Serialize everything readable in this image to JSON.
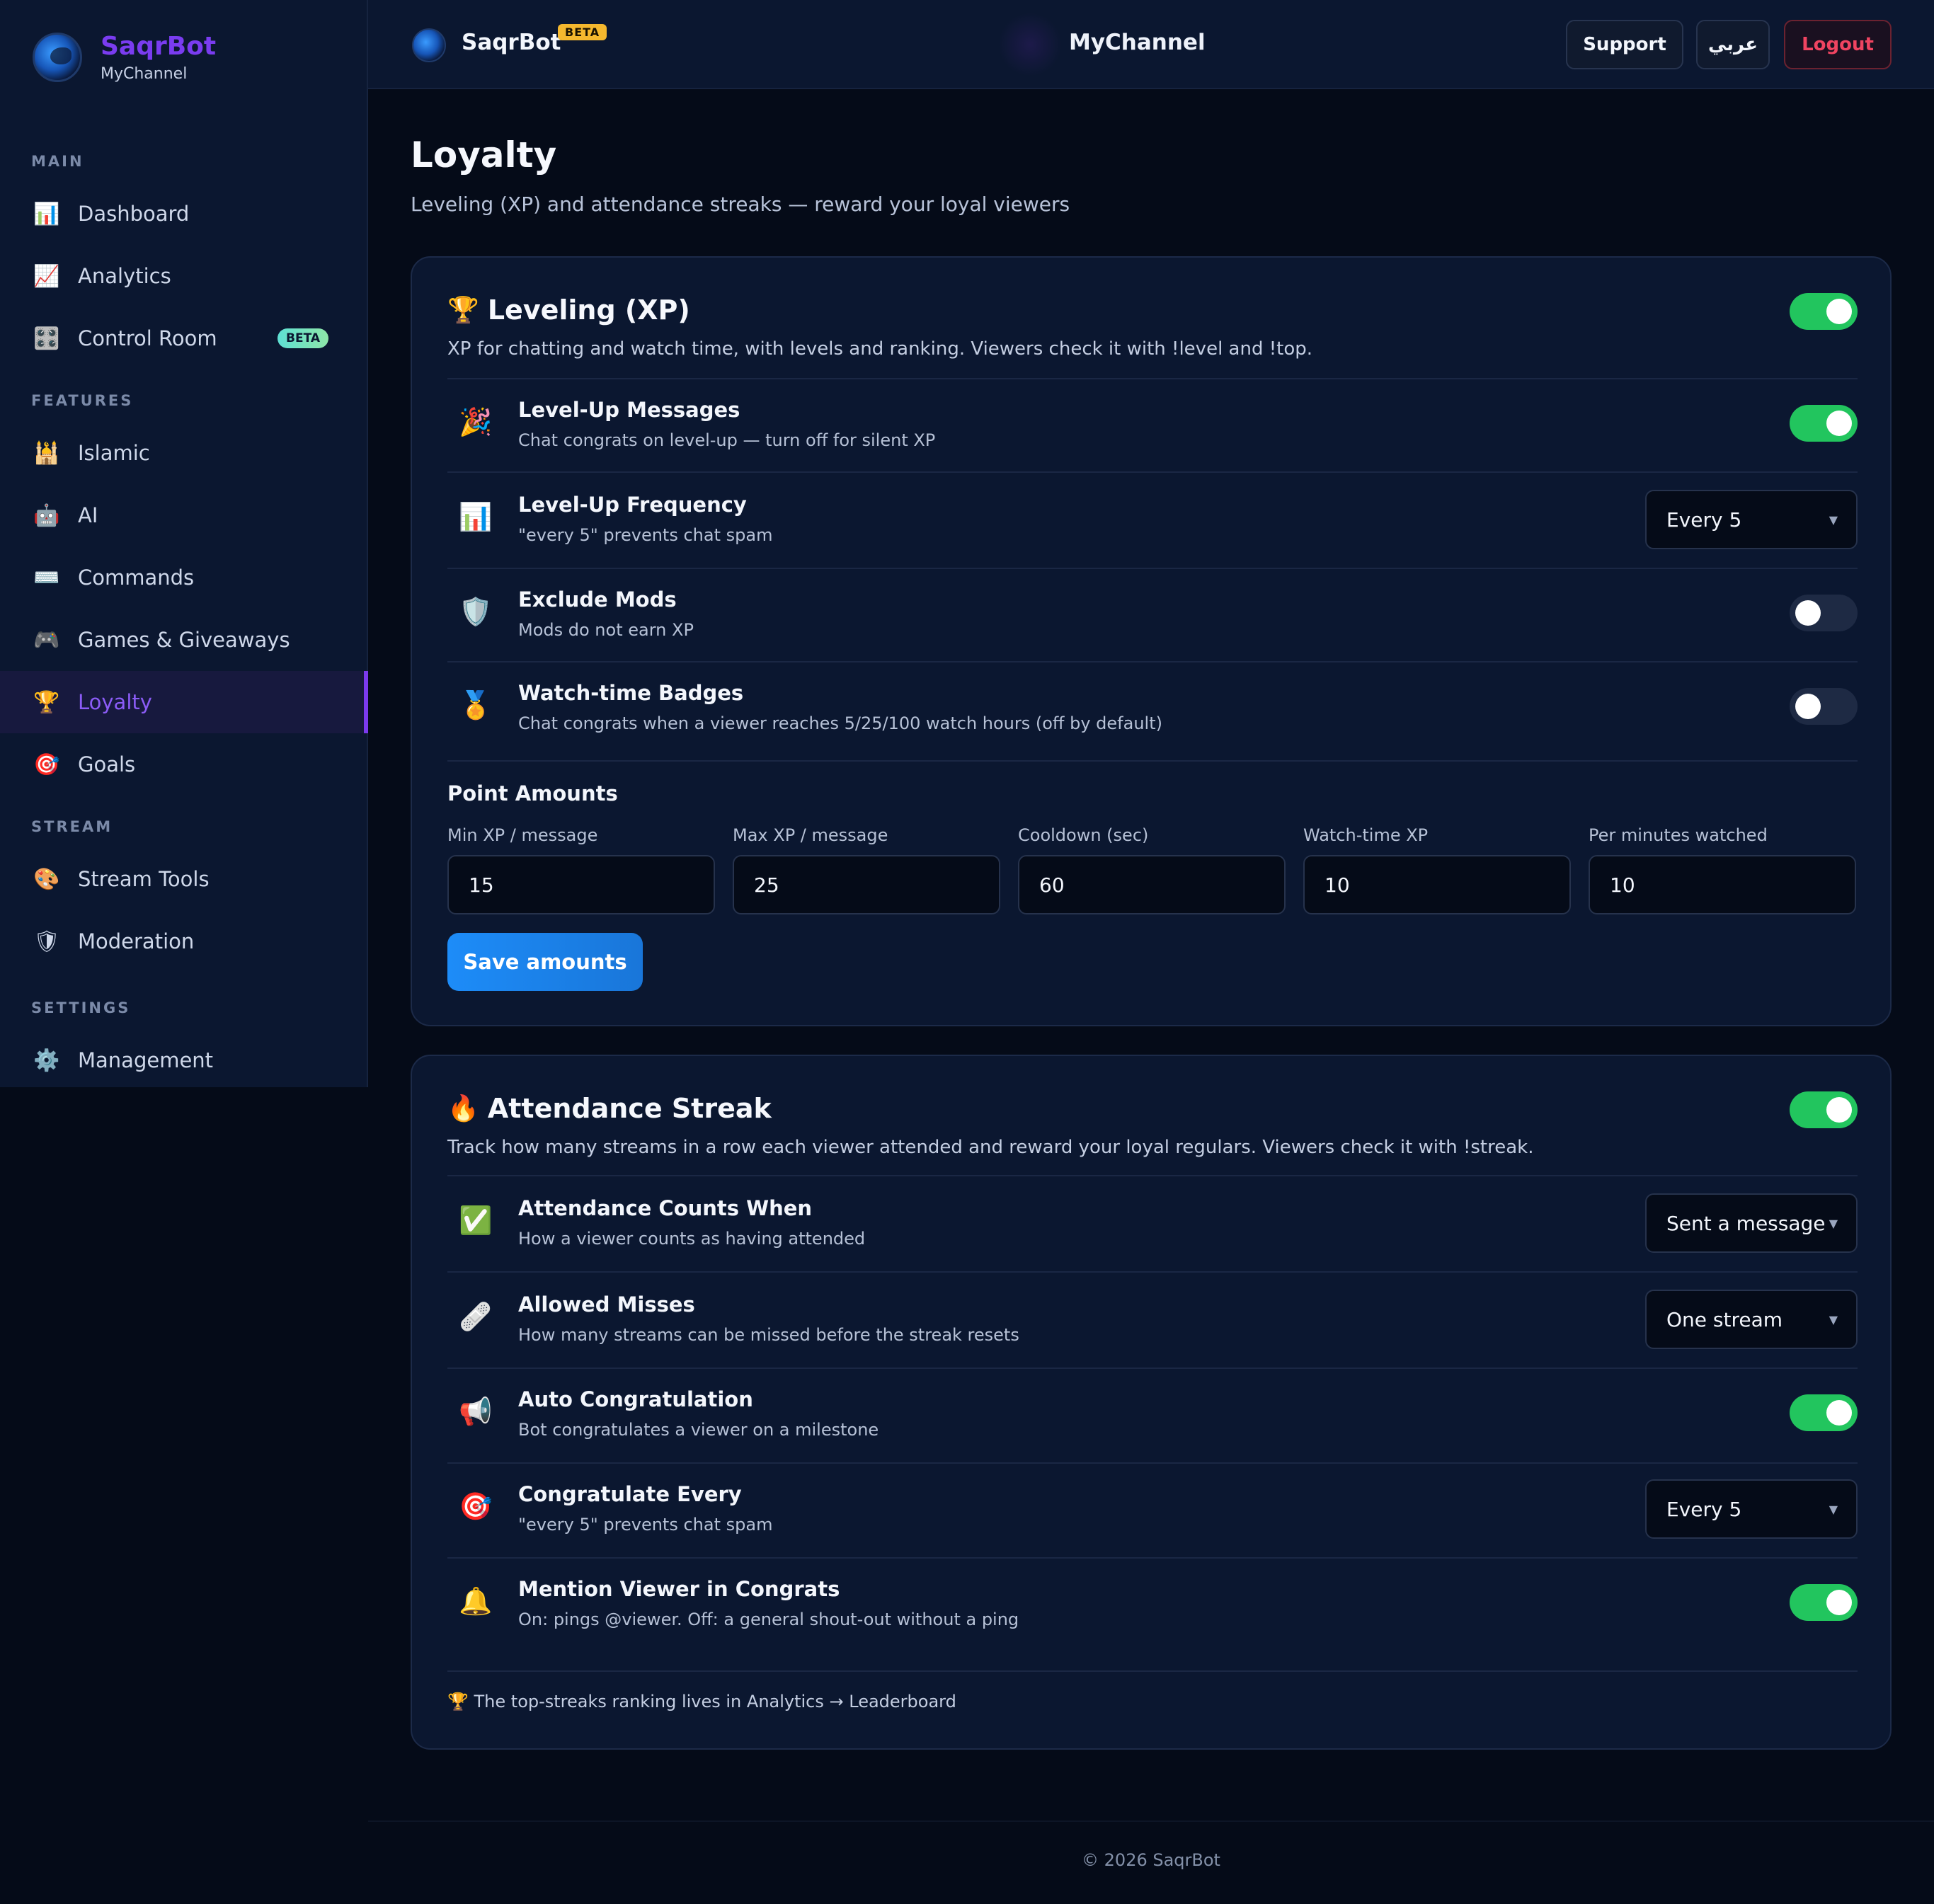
{
  "brand": {
    "name": "SaqrBot",
    "channel": "MyChannel"
  },
  "topbar": {
    "name": "SaqrBot",
    "beta": "BETA",
    "channel": "MyChannel",
    "support": "Support",
    "lang": "عربي",
    "logout": "Logout"
  },
  "sidebar": {
    "sections": {
      "main": "MAIN",
      "features": "FEATURES",
      "stream": "STREAM",
      "settings": "SETTINGS"
    },
    "items": [
      {
        "label": "Dashboard",
        "icon": "📊"
      },
      {
        "label": "Analytics",
        "icon": "📈"
      },
      {
        "label": "Control Room",
        "icon": "🎛️",
        "badge": "BETA"
      },
      {
        "label": "Islamic",
        "icon": "🕌"
      },
      {
        "label": "AI",
        "icon": "🤖"
      },
      {
        "label": "Commands",
        "icon": "⌨️"
      },
      {
        "label": "Games & Giveaways",
        "icon": "🎮"
      },
      {
        "label": "Loyalty",
        "icon": "🏆",
        "active": true
      },
      {
        "label": "Goals",
        "icon": "🎯"
      },
      {
        "label": "Stream Tools",
        "icon": "🎨"
      },
      {
        "label": "Moderation",
        "icon": "🛡"
      },
      {
        "label": "Management",
        "icon": "⚙️"
      }
    ]
  },
  "page": {
    "title": "Loyalty",
    "subtitle": "Leveling (XP) and attendance streaks — reward your loyal viewers"
  },
  "leveling": {
    "icon": "🏆",
    "title": "Leveling (XP)",
    "enabled": true,
    "description": "XP for chatting and watch time, with levels and ranking. Viewers check it with !level and !top.",
    "rows": [
      {
        "icon": "🎉",
        "title": "Level-Up Messages",
        "sub": "Chat congrats on level-up — turn off for silent XP",
        "toggle": true
      },
      {
        "icon": "📊",
        "title": "Level-Up Frequency",
        "sub": "\"every 5\" prevents chat spam",
        "select": "Every 5"
      },
      {
        "icon": "🛡️",
        "title": "Exclude Mods",
        "sub": "Mods do not earn XP",
        "toggle": false
      },
      {
        "icon": "🏅",
        "title": "Watch-time Badges",
        "sub": "Chat congrats when a viewer reaches 5/25/100 watch hours (off by default)",
        "toggle": false
      }
    ],
    "amounts": {
      "title": "Point Amounts",
      "fields": [
        {
          "label": "Min XP / message",
          "value": "15"
        },
        {
          "label": "Max XP / message",
          "value": "25"
        },
        {
          "label": "Cooldown (sec)",
          "value": "60"
        },
        {
          "label": "Watch-time XP",
          "value": "10"
        },
        {
          "label": "Per minutes watched",
          "value": "10"
        }
      ],
      "save": "Save amounts"
    }
  },
  "attendance": {
    "icon": "🔥",
    "title": "Attendance Streak",
    "enabled": true,
    "description": "Track how many streams in a row each viewer attended and reward your loyal regulars. Viewers check it with !streak.",
    "rows": [
      {
        "icon": "✅",
        "title": "Attendance Counts When",
        "sub": "How a viewer counts as having attended",
        "select": "Sent a message"
      },
      {
        "icon": "🩹",
        "title": "Allowed Misses",
        "sub": "How many streams can be missed before the streak resets",
        "select": "One stream"
      },
      {
        "icon": "📢",
        "title": "Auto Congratulation",
        "sub": "Bot congratulates a viewer on a milestone",
        "toggle": true
      },
      {
        "icon": "🎯",
        "title": "Congratulate Every",
        "sub": "\"every 5\" prevents chat spam",
        "select": "Every 5"
      },
      {
        "icon": "🔔",
        "title": "Mention Viewer in Congrats",
        "sub": "On: pings @viewer. Off: a general shout-out without a ping",
        "toggle": true
      }
    ],
    "note": "🏆 The top-streaks ranking lives in Analytics → Leaderboard"
  },
  "footer": "© 2026 SaqrBot",
  "colors": {
    "accent_purple": "#7c3aed",
    "toggle_on": "#22c55e",
    "primary_button": "#1d8cf8",
    "logout": "#f04461",
    "background": "#050b18",
    "card": "#0b1730"
  }
}
